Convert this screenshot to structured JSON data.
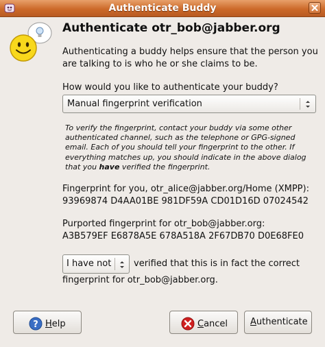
{
  "window": {
    "title": "Authenticate Buddy"
  },
  "header": {
    "title": "Authenticate otr_bob@jabber.org"
  },
  "intro": {
    "line1": "Authenticating a buddy helps ensure that the person you",
    "line2": "are talking to is who he or she claims to be."
  },
  "method": {
    "question": "How would you like to authenticate your buddy?",
    "selected": "Manual fingerprint verification"
  },
  "instructions": {
    "line1": "To verify the fingerprint, contact your buddy via some other",
    "line2": "authenticated channel, such as the telephone or GPG-signed",
    "line3": "email.  Each of you should tell your fingerprint to the other. If",
    "line4": "everything matches up, you should indicate in the above dialog",
    "line5_pre": "that you ",
    "line5_bold": "have",
    "line5_post": " verified the fingerprint."
  },
  "fingerprints": {
    "yours_label": "Fingerprint for you, otr_alice@jabber.org/Home (XMPP):",
    "yours_value": "93969874 D4AA01BE 981DF59A CD01D16D 07024542",
    "buddy_label": "Purported fingerprint for otr_bob@jabber.org:",
    "buddy_value": "A3B579EF E6878A5E 678A518A 2F67DB70 D0E68FE0"
  },
  "verification": {
    "selected": "I have not",
    "text_line1": "verified that this is in fact the correct",
    "text_line2": "fingerprint for otr_bob@jabber.org."
  },
  "buttons": {
    "help": "Help",
    "cancel": "Cancel",
    "authenticate": "Authenticate"
  },
  "icons": {
    "app": "pidgin-icon",
    "close": "close-icon",
    "smiley": "smiley-lightbulb-icon",
    "help": "help-icon",
    "cancel": "cancel-icon"
  },
  "colors": {
    "titlebar": "#cc6a2a",
    "window_bg": "#efebe7"
  }
}
